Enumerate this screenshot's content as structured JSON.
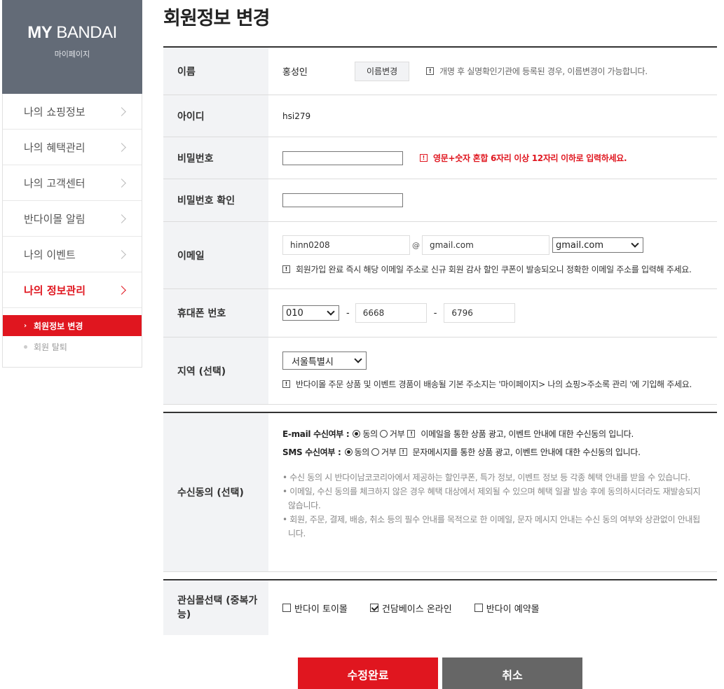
{
  "sidebar": {
    "brand": {
      "title_bold": "MY",
      "title_rest": " BANDAI",
      "subtitle": "마이페이지"
    },
    "items": [
      {
        "label": "나의 쇼핑정보"
      },
      {
        "label": "나의 혜택관리"
      },
      {
        "label": "나의 고객센터"
      },
      {
        "label": "반다이몰 알림"
      },
      {
        "label": "나의 이벤트"
      },
      {
        "label": "나의 정보관리"
      }
    ],
    "submenu": [
      {
        "label": "회원정보 변경"
      },
      {
        "label": "회원 탈퇴"
      }
    ]
  },
  "page": {
    "title": "회원정보 변경"
  },
  "form": {
    "name": {
      "label": "이름",
      "value": "홍성인",
      "button": "이름변경",
      "note": "개명 후 실명확인기관에 등록된 경우, 이름변경이 가능합니다."
    },
    "id": {
      "label": "아이디",
      "value": "hsi279"
    },
    "password": {
      "label": "비밀번호",
      "value": "",
      "note": "영문+숫자 혼합 6자리 이상 12자리 이하로 입력하세요."
    },
    "password_confirm": {
      "label": "비밀번호 확인",
      "value": ""
    },
    "email": {
      "label": "이메일",
      "local": "hinn0208",
      "at": "@",
      "domain": "gmail.com",
      "domain_select": "gmail.com",
      "note": "회원가입 완료 즉시 해당 이메일 주소로 신규 회원 감사 할인 쿠폰이 발송되오니 정확한 이메일 주소를 입력해 주세요."
    },
    "phone": {
      "label": "휴대폰 번호",
      "prefix": "010",
      "dash": "-",
      "middle": "6668",
      "last": "6796"
    },
    "region": {
      "label": "지역 (선택)",
      "value": "서울특별시",
      "note": "반다이몰 주문 상품 및 이벤트 경품이 배송될 기본 주소지는 '마이페이지> 나의 쇼핑>주소록 관리 '에 기입해 주세요."
    },
    "consent": {
      "label": "수신동의 (선택)",
      "email_label": "E-mail 수신여부 :",
      "sms_label": "SMS 수신여부 :",
      "agree": "동의",
      "disagree": "거부",
      "email_note": "이메일을 통한 상품 광고, 이벤트 안내에 대한 수신동의 입니다.",
      "sms_note": "문자메시지를 통한 상품 광고, 이벤트 안내에 대한 수신동의 입니다.",
      "bullets": [
        "수신 동의 시 반다이남코코리아에서 제공하는 할인쿠폰, 특가 정보, 이벤트 정보 등 각종 혜택 안내를 받을 수 있습니다.",
        "이메일, 수신 동의를 체크하지 않은 경우 혜택 대상에서 제외될 수 있으며 혜택 일괄 발송 후에 동의하시더라도 재발송되지 않습니다.",
        "회원, 주문, 결제, 배송, 취소 등의 필수 안내를 목적으로 한 이메일, 문자 메시지 안내는 수신 동의 여부와 상관없이 안내됩니다."
      ]
    },
    "interest": {
      "label": "관심몰선택 (중복가능)",
      "options": [
        {
          "label": "반다이 토이몰",
          "checked": false
        },
        {
          "label": "건담베이스 온라인",
          "checked": true
        },
        {
          "label": "반다이 예약몰",
          "checked": false
        }
      ]
    }
  },
  "actions": {
    "submit": "수정완료",
    "cancel": "취소"
  },
  "colors": {
    "accent": "#e0161f",
    "brand_bg": "#636b77",
    "cancel_bg": "#666666"
  }
}
